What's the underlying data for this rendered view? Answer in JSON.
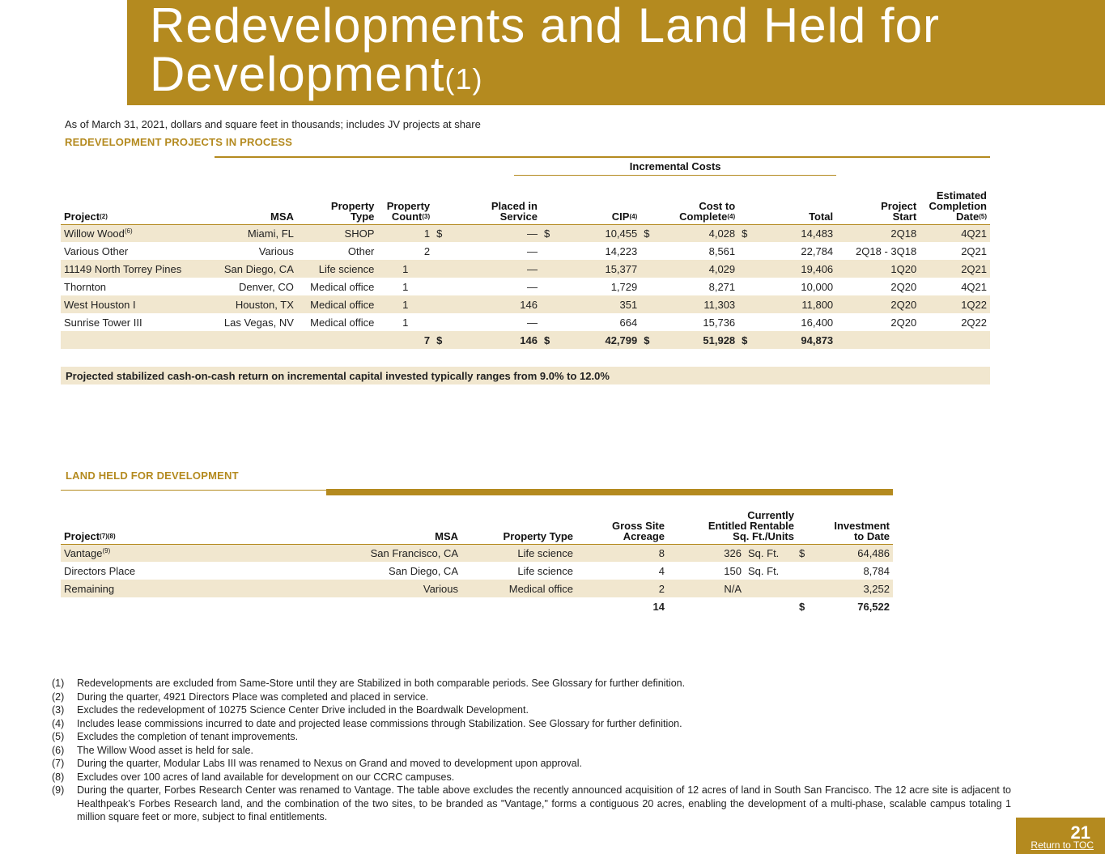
{
  "title": {
    "line1": "Redevelopments and Land Held for",
    "line2": "Development",
    "sup": "(1)"
  },
  "subtitle": "As of March 31, 2021, dollars and square feet in thousands; includes JV projects at share",
  "redev": {
    "section": "REDEVELOPMENT PROJECTS IN PROCESS",
    "group_header": "Incremental Costs",
    "headers": {
      "project": "Project",
      "project_sup": "(2)",
      "msa": "MSA",
      "ptype": [
        "Property",
        "Type"
      ],
      "pcount": [
        "Property",
        "Count"
      ],
      "pcount_sup": "(3)",
      "placed": [
        "Placed in",
        "Service"
      ],
      "cip": "CIP",
      "cip_sup": "(4)",
      "ctc": [
        "Cost to",
        "Complete"
      ],
      "ctc_sup": "(4)",
      "total": "Total",
      "start": [
        "Project",
        "Start"
      ],
      "ecd": [
        "Estimated",
        "Completion",
        "Date"
      ],
      "ecd_sup": "(5)"
    },
    "rows": [
      {
        "project": "Willow Wood",
        "sup": "(6)",
        "msa": "Miami, FL",
        "ptype": "SHOP",
        "count": "1",
        "d1": "$",
        "placed": "—",
        "d2": "$",
        "cip": "10,455",
        "d3": "$",
        "ctc": "4,028",
        "d4": "$",
        "total": "14,483",
        "start": "2Q18",
        "ecd": "4Q21"
      },
      {
        "project": "Various Other",
        "sup": "",
        "msa": "Various",
        "ptype": "Other",
        "count": "2",
        "d1": "",
        "placed": "—",
        "d2": "",
        "cip": "14,223",
        "d3": "",
        "ctc": "8,561",
        "d4": "",
        "total": "22,784",
        "start": "2Q18 - 3Q18",
        "ecd": "2Q21"
      },
      {
        "project": "11149 North Torrey Pines",
        "sup": "",
        "msa": "San Diego, CA",
        "ptype": "Life science",
        "count": "1",
        "d1": "",
        "placed": "—",
        "d2": "",
        "cip": "15,377",
        "d3": "",
        "ctc": "4,029",
        "d4": "",
        "total": "19,406",
        "start": "1Q20",
        "ecd": "2Q21"
      },
      {
        "project": "Thornton",
        "sup": "",
        "msa": "Denver, CO",
        "ptype": "Medical office",
        "count": "1",
        "d1": "",
        "placed": "—",
        "d2": "",
        "cip": "1,729",
        "d3": "",
        "ctc": "8,271",
        "d4": "",
        "total": "10,000",
        "start": "2Q20",
        "ecd": "4Q21"
      },
      {
        "project": "West Houston I",
        "sup": "",
        "msa": "Houston, TX",
        "ptype": "Medical office",
        "count": "1",
        "d1": "",
        "placed": "146",
        "d2": "",
        "cip": "351",
        "d3": "",
        "ctc": "11,303",
        "d4": "",
        "total": "11,800",
        "start": "2Q20",
        "ecd": "1Q22"
      },
      {
        "project": "Sunrise Tower III",
        "sup": "",
        "msa": "Las Vegas, NV",
        "ptype": "Medical office",
        "count": "1",
        "d1": "",
        "placed": "—",
        "d2": "",
        "cip": "664",
        "d3": "",
        "ctc": "15,736",
        "d4": "",
        "total": "16,400",
        "start": "2Q20",
        "ecd": "2Q22"
      }
    ],
    "total": {
      "count": "7",
      "d1": "$",
      "placed": "146",
      "d2": "$",
      "cip": "42,799",
      "d3": "$",
      "ctc": "51,928",
      "d4": "$",
      "total": "94,873"
    },
    "callout": "Projected stabilized cash-on-cash return on incremental capital invested typically ranges from 9.0% to 12.0%"
  },
  "land": {
    "section": "LAND HELD FOR DEVELOPMENT",
    "headers": {
      "project": "Project",
      "project_sup": "(7)(8)",
      "msa": "MSA",
      "ptype": "Property Type",
      "acre": [
        "Gross Site",
        "Acreage"
      ],
      "sqft": [
        "Currently",
        "Entitled Rentable",
        "Sq. Ft./Units"
      ],
      "inv": [
        "Investment",
        "to Date"
      ]
    },
    "rows": [
      {
        "project": "Vantage",
        "sup": "(9)",
        "msa": "San Francisco, CA",
        "ptype": "Life science",
        "acre": "8",
        "sqft": "326",
        "unit": "Sq. Ft.",
        "d": "$",
        "inv": "64,486"
      },
      {
        "project": "Directors Place",
        "sup": "",
        "msa": "San Diego, CA",
        "ptype": "Life science",
        "acre": "4",
        "sqft": "150",
        "unit": "Sq. Ft.",
        "d": "",
        "inv": "8,784"
      },
      {
        "project": "Remaining",
        "sup": "",
        "msa": "Various",
        "ptype": "Medical office",
        "acre": "2",
        "sqft": "N/A",
        "unit": "",
        "d": "",
        "inv": "3,252"
      }
    ],
    "total": {
      "acre": "14",
      "d": "$",
      "inv": "76,522"
    }
  },
  "footnotes": [
    {
      "num": "(1)",
      "text": "Redevelopments are excluded from Same-Store until they are Stabilized in both comparable periods. See Glossary for further definition."
    },
    {
      "num": "(2)",
      "text": "During the quarter, 4921 Directors Place was completed and placed in service."
    },
    {
      "num": "(3)",
      "text": "Excludes the redevelopment of 10275 Science Center Drive included in the Boardwalk Development."
    },
    {
      "num": "(4)",
      "text": "Includes lease commissions incurred to date and projected lease commissions through Stabilization. See Glossary for further definition."
    },
    {
      "num": "(5)",
      "text": "Excludes the completion of tenant improvements."
    },
    {
      "num": "(6)",
      "text": "The Willow Wood asset is held for sale."
    },
    {
      "num": "(7)",
      "text": "During the quarter, Modular Labs III was renamed to Nexus on Grand and moved to development upon approval."
    },
    {
      "num": "(8)",
      "text": "Excludes over 100 acres of land available for development on our CCRC campuses."
    },
    {
      "num": "(9)",
      "text": "During the quarter, Forbes Research Center was renamed to Vantage.  The table above excludes the recently announced acquisition of 12 acres of land in South San Francisco. The 12 acre site is adjacent to Healthpeak’s Forbes Research land, and the combination of the two sites, to be branded as \"Vantage,\" forms a contiguous 20 acres, enabling the development of a multi-phase, scalable campus totaling 1 million square feet or more, subject to final entitlements."
    }
  ],
  "page": {
    "number": "21",
    "toc": "Return to TOC"
  }
}
